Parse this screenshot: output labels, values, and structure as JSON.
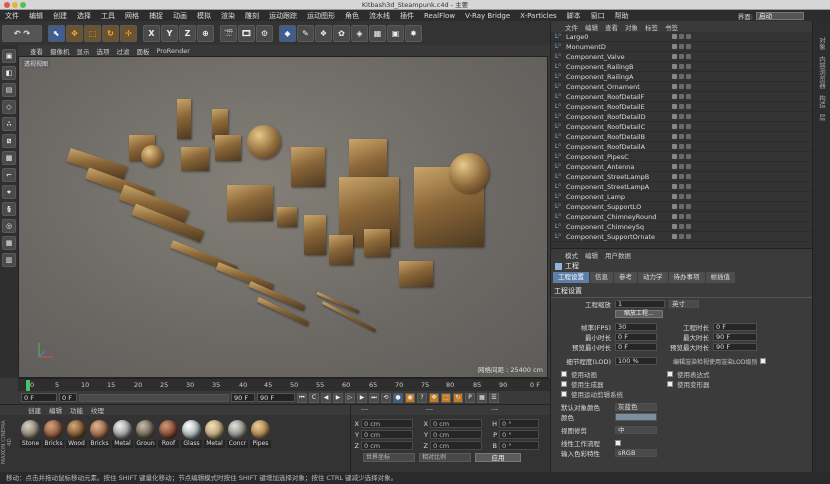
{
  "window": {
    "title": "Kitbash3d_Steampunk.c4d - 主要"
  },
  "menu": [
    "文件",
    "编辑",
    "创建",
    "选择",
    "工具",
    "网格",
    "捕捉",
    "动画",
    "模拟",
    "渲染",
    "雕刻",
    "运动跟踪",
    "运动图形",
    "角色",
    "流水线",
    "插件",
    "RealFlow",
    "V-Ray Bridge",
    "X-Particles",
    "脚本",
    "窗口",
    "帮助"
  ],
  "layout": {
    "label": "界面:",
    "value": "启动"
  },
  "viewport": {
    "menu": [
      "查看",
      "摄像机",
      "显示",
      "选项",
      "过滤",
      "面板",
      "ProRender"
    ],
    "label": "透视视图",
    "grid_info": "网格间距 : 25400 cm"
  },
  "timeline": {
    "ticks": [
      "0",
      "5",
      "10",
      "15",
      "20",
      "25",
      "30",
      "35",
      "40",
      "45",
      "50",
      "55",
      "60",
      "65",
      "70",
      "75",
      "80",
      "85",
      "90"
    ],
    "unit": "0 F"
  },
  "playback": {
    "start": "0 F",
    "current": "0 F",
    "end": "90 F",
    "end2": "90 F"
  },
  "materials": {
    "menu": [
      "创建",
      "编辑",
      "功能",
      "纹理"
    ],
    "items": [
      {
        "name": "Stone",
        "color": "#8a8378"
      },
      {
        "name": "Bricks",
        "color": "#8b5a3c"
      },
      {
        "name": "Wood",
        "color": "#7a5430"
      },
      {
        "name": "Bricks",
        "color": "#9a6a48"
      },
      {
        "name": "Metal",
        "color": "#9c9c9c"
      },
      {
        "name": "Groun",
        "color": "#6e6458"
      },
      {
        "name": "Roof",
        "color": "#7e4a34"
      },
      {
        "name": "Glass",
        "color": "#a9b4b8"
      },
      {
        "name": "Metal",
        "color": "#b8a27a"
      },
      {
        "name": "Concr",
        "color": "#8f8d88"
      },
      {
        "name": "Pipes",
        "color": "#a68452"
      }
    ],
    "logo": "MAXON CINEMA 4D"
  },
  "coords": {
    "header": [
      "---",
      "---",
      "---"
    ],
    "rows": [
      {
        "a": "X",
        "av": "0 cm",
        "b": "X",
        "bv": "0 cm",
        "c": "H",
        "cv": "0 °"
      },
      {
        "a": "Y",
        "av": "0 cm",
        "b": "Y",
        "bv": "0 cm",
        "c": "P",
        "cv": "0 °"
      },
      {
        "a": "Z",
        "av": "0 cm",
        "b": "Z",
        "bv": "0 cm",
        "c": "B",
        "cv": "0 °"
      }
    ],
    "mode1": "世界坐标",
    "mode2": "相对比例",
    "apply": "应用"
  },
  "status": "移动：点击并拖动鼠标移动元素。按住 SHIFT 键量化移动；节点编辑模式时按住 SHIFT 键增加选择对象；按住 CTRL 键减少选择对象。",
  "objects": {
    "menu": [
      "文件",
      "编辑",
      "查看",
      "对象",
      "标签",
      "书签"
    ],
    "items": [
      "Large0",
      "MonumentD",
      "Component_Valve",
      "Component_RailingB",
      "Component_RailingA",
      "Component_Ornament",
      "Component_RoofDetailF",
      "Component_RoofDetailE",
      "Component_RoofDetailD",
      "Component_RoofDetailC",
      "Component_RoofDetailB",
      "Component_RoofDetailA",
      "Component_PipesC",
      "Component_Antenna",
      "Component_StreetLampB",
      "Component_StreetLampA",
      "Component_Lamp",
      "Component_SupportLO",
      "Component_ChimneyRound",
      "Component_ChimneySq",
      "Component_SupportOrnate"
    ]
  },
  "right_tabs": [
    "对象",
    "内容浏览器",
    "构造",
    "层"
  ],
  "attributes": {
    "menu": [
      "模式",
      "编辑",
      "用户数据"
    ],
    "title": "工程",
    "tabs": [
      "工程设置",
      "信息",
      "参考",
      "动力学",
      "待办事项",
      "帧插值"
    ],
    "section": "工程设置",
    "scale_label": "工程缩放",
    "scale_value": "1",
    "scale_unit": "英寸",
    "scale_button": "缩放工程...",
    "left_fields": [
      {
        "label": "帧率(FPS)",
        "value": "30"
      },
      {
        "label": "最小时长",
        "value": "0 F"
      },
      {
        "label": "预览最小时长",
        "value": "0 F"
      }
    ],
    "right_fields": [
      {
        "label": "工程时长",
        "value": "0 F"
      },
      {
        "label": "最大时长",
        "value": "90 F"
      },
      {
        "label": "预览最大时长",
        "value": "90 F"
      }
    ],
    "lod_label": "细节程度(LOD)",
    "lod_value": "100 %",
    "lod_check": "编辑渲染检视使用渲染LOD级别",
    "checks_left": [
      "使用动画",
      "使用生成器",
      "使用运动剪辑系统"
    ],
    "checks_right": [
      "使用表达式",
      "使用变形器"
    ],
    "default_color_label": "默认对象颜色",
    "default_color_value": "灰蓝色",
    "color_label": "颜色",
    "view_clip_label": "视图修剪",
    "view_clip_value": "中",
    "linear_label": "线性工作流程",
    "input_color_label": "输入色彩特性",
    "input_color_value": "sRGB"
  }
}
